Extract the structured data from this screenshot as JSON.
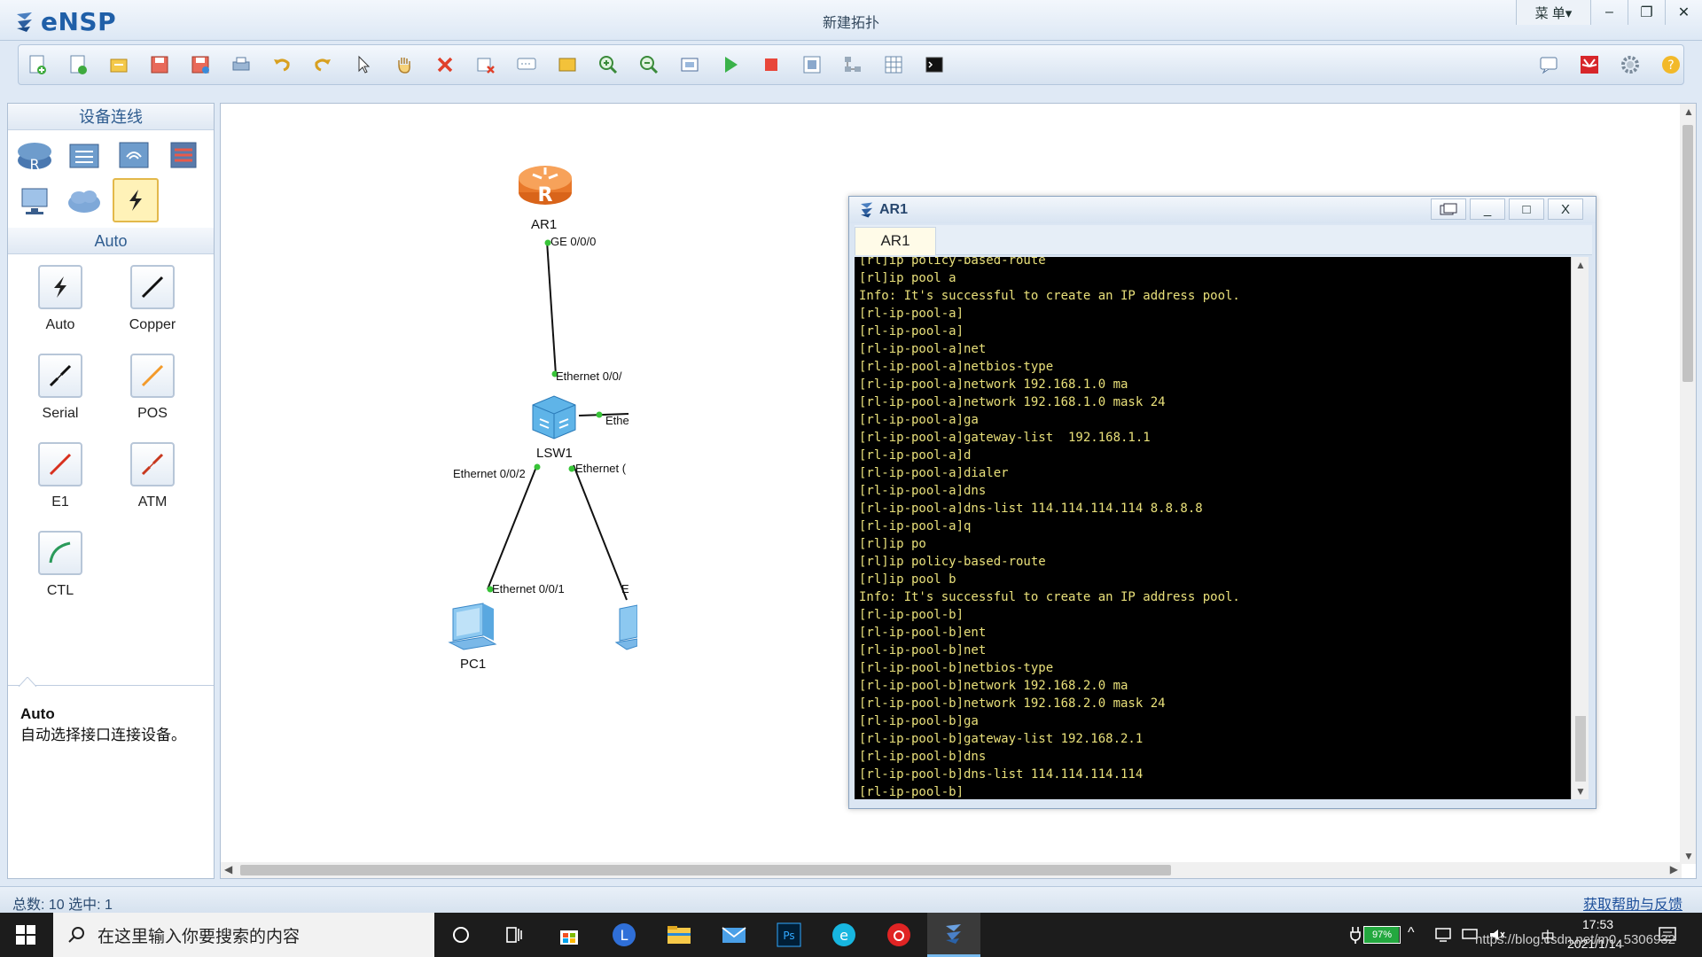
{
  "app": {
    "logo_text": "eNSP",
    "window_title": "新建拓扑",
    "menu_label": "菜 单▾",
    "minimize": "–",
    "restore": "❐",
    "close": "✕"
  },
  "left_panel": {
    "section_devices": "设备连线",
    "section_cables": "Auto",
    "cables": [
      {
        "label": "Auto"
      },
      {
        "label": "Copper"
      },
      {
        "label": "Serial"
      },
      {
        "label": "POS"
      },
      {
        "label": "E1"
      },
      {
        "label": "ATM"
      },
      {
        "label": "CTL"
      }
    ],
    "desc_title": "Auto",
    "desc_text": "自动选择接口连接设备。"
  },
  "topology": {
    "nodes": {
      "ar1": "AR1",
      "lsw1": "LSW1",
      "pc1": "PC1"
    },
    "ports": {
      "ar1_ge": "GE 0/0/0",
      "lsw_up": "Ethernet 0/0/",
      "lsw_right": "Ethe",
      "lsw_left": "Ethernet 0/0/2",
      "lsw_down": "Ethernet (",
      "pc1_port": "Ethernet 0/0/1",
      "pc2_port": "E"
    }
  },
  "terminal": {
    "window_title": "AR1",
    "tab_label": "AR1",
    "btn_minimize": "_",
    "btn_maximize": "□",
    "btn_close": "X",
    "lines": [
      "[rl]ip policy-based-route",
      "[rl]ip pool a",
      "Info: It's successful to create an IP address pool.",
      "[rl-ip-pool-a]",
      "[rl-ip-pool-a]",
      "[rl-ip-pool-a]net",
      "[rl-ip-pool-a]netbios-type",
      "[rl-ip-pool-a]network 192.168.1.0 ma",
      "[rl-ip-pool-a]network 192.168.1.0 mask 24",
      "[rl-ip-pool-a]ga",
      "[rl-ip-pool-a]gateway-list  192.168.1.1",
      "[rl-ip-pool-a]d",
      "[rl-ip-pool-a]dialer",
      "[rl-ip-pool-a]dns",
      "[rl-ip-pool-a]dns-list 114.114.114.114 8.8.8.8",
      "[rl-ip-pool-a]q",
      "[rl]ip po",
      "[rl]ip policy-based-route",
      "[rl]ip pool b",
      "Info: It's successful to create an IP address pool.",
      "[rl-ip-pool-b]",
      "[rl-ip-pool-b]ent",
      "[rl-ip-pool-b]net",
      "[rl-ip-pool-b]netbios-type",
      "[rl-ip-pool-b]network 192.168.2.0 ma",
      "[rl-ip-pool-b]network 192.168.2.0 mask 24",
      "[rl-ip-pool-b]ga",
      "[rl-ip-pool-b]gateway-list 192.168.2.1",
      "[rl-ip-pool-b]dns",
      "[rl-ip-pool-b]dns-list 114.114.114.114",
      "[rl-ip-pool-b]"
    ]
  },
  "statusbar": {
    "left_text": "总数:  10  选中:  1",
    "help_link": "获取帮助与反馈"
  },
  "taskbar": {
    "search_placeholder": "在这里输入你要搜索的内容",
    "battery": "97%",
    "ime": "中",
    "time": "17:53",
    "date": "2021/1/14",
    "watermark": "https://blog.csdn.net/m0_5306932"
  },
  "colors": {
    "accent": "#1f5fa8",
    "console_bg": "#000000",
    "console_fg": "#e9e07a",
    "link_dot": "#38c438"
  }
}
